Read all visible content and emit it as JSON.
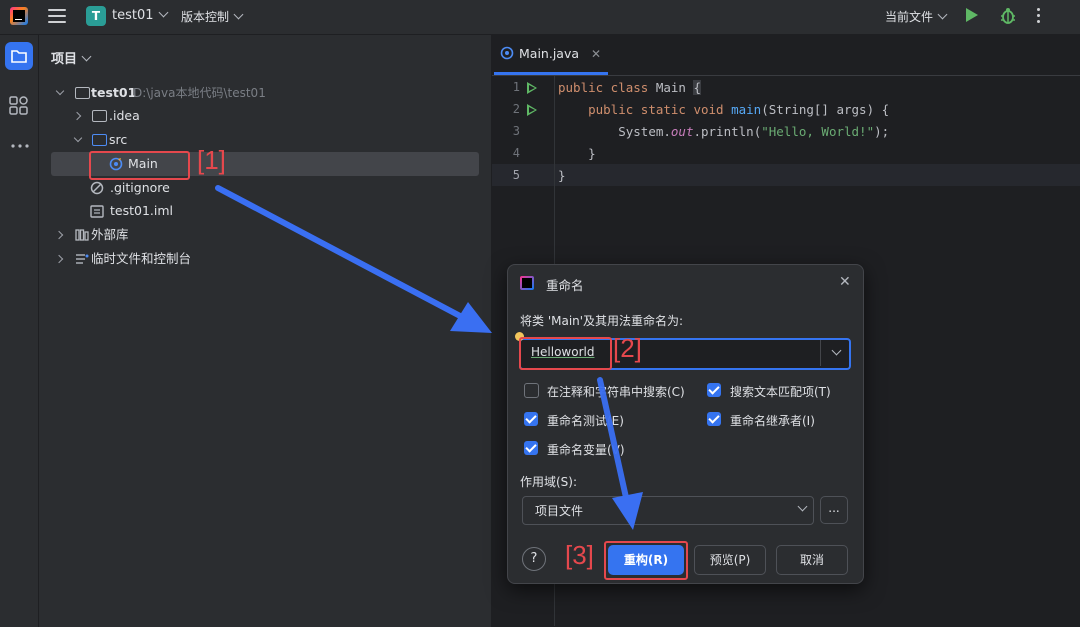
{
  "titlebar": {
    "project_initial": "T",
    "project_name": "test01",
    "vcs_label": "版本控制",
    "current_file_label": "当前文件"
  },
  "panel": {
    "title": "项目",
    "tree": {
      "root_name": "test01",
      "root_path": "D:\\java本地代码\\test01",
      "idea": ".idea",
      "src": "src",
      "main": "Main",
      "gitignore": ".gitignore",
      "iml": "test01.iml",
      "external_libs": "外部库",
      "scratches": "临时文件和控制台"
    }
  },
  "editor": {
    "tab_label": "Main.java",
    "line_numbers": [
      "1",
      "2",
      "3",
      "4",
      "5"
    ],
    "lines": {
      "l1_kw": "public class ",
      "l1_name": "Main ",
      "l1_brace": "{",
      "l2_indent": "    ",
      "l2_kw": "public static void ",
      "l2_fn": "main",
      "l2_rest": "(String[] args) {",
      "l3_indent": "        ",
      "l3_a": "System.",
      "l3_out": "out",
      "l3_b": ".println(",
      "l3_str": "\"Hello, World!\"",
      "l3_c": ");",
      "l4": "    }",
      "l5": "}"
    }
  },
  "dialog": {
    "title": "重命名",
    "prompt": "将类 'Main'及其用法重命名为:",
    "new_name_value": "Helloworld",
    "options": {
      "search_comments": "在注释和字符串中搜索(C)",
      "search_text": "搜索文本匹配项(T)",
      "rename_tests": "重命名测试(E)",
      "rename_inheritors": "重命名继承者(I)",
      "rename_variables": "重命名变量(V)"
    },
    "scope_label": "作用域(S):",
    "scope_value": "项目文件",
    "scope_more": "...",
    "help": "?",
    "refactor_button": "重构(R)",
    "preview_button": "预览(P)",
    "cancel_button": "取消"
  },
  "annotations": {
    "label1": "[1]",
    "label2": "[2]",
    "label3": "[3]"
  },
  "colors": {
    "accent": "#3574f0",
    "annotation_red": "#e5484d",
    "arrow_blue": "#3a6ff2"
  }
}
